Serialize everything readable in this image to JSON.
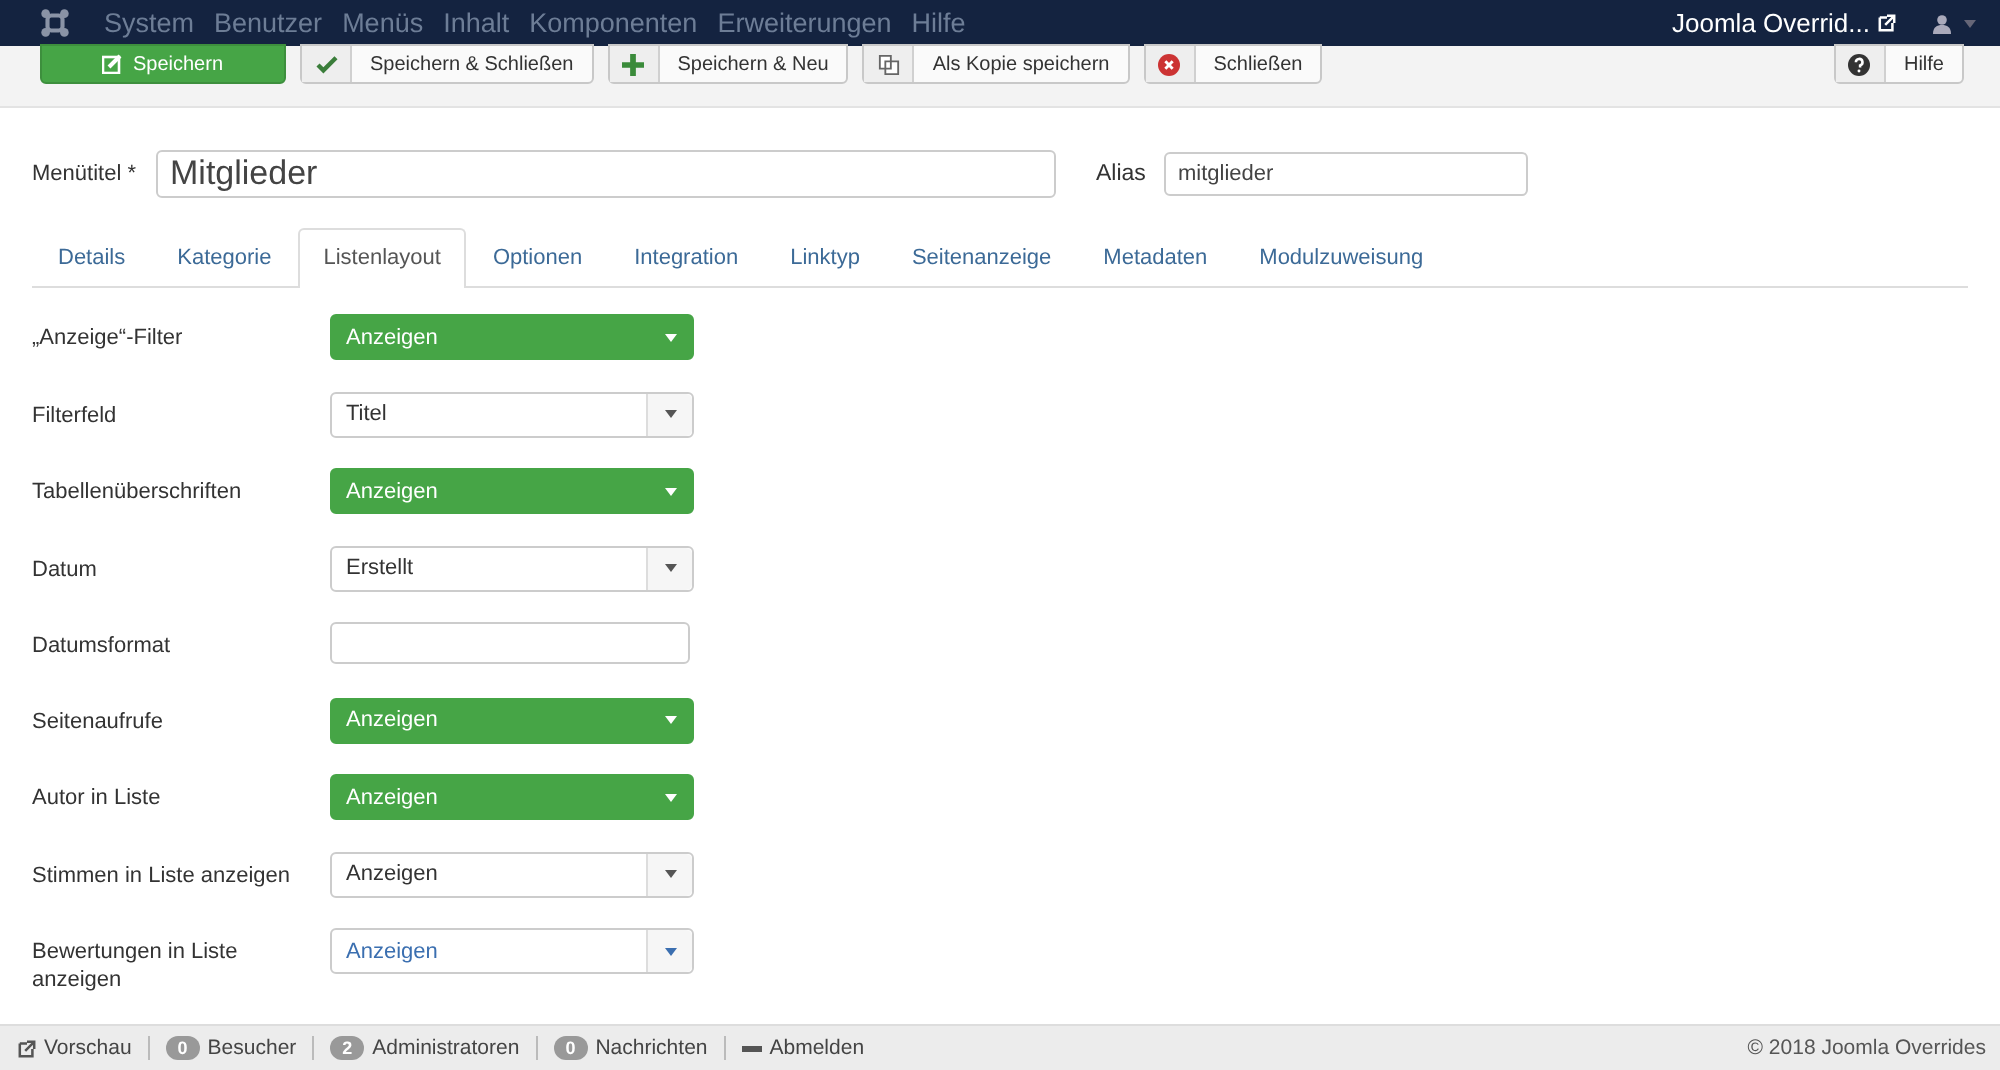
{
  "navbar": {
    "menu": [
      "System",
      "Benutzer",
      "Menüs",
      "Inhalt",
      "Komponenten",
      "Erweiterungen",
      "Hilfe"
    ],
    "site_link": "Joomla Overrid..."
  },
  "toolbar": {
    "buttons": [
      {
        "label": "Speichern",
        "kind": "primary"
      },
      {
        "label": "Speichern & Schließen",
        "kind": "default"
      },
      {
        "label": "Speichern & Neu",
        "kind": "default"
      },
      {
        "label": "Als Kopie speichern",
        "kind": "default"
      },
      {
        "label": "Schließen",
        "kind": "default"
      }
    ],
    "help_button": "Hilfe"
  },
  "title_row": {
    "label": "Menütitel *",
    "value": "Mitglieder",
    "alias_label": "Alias",
    "alias_value": "mitglieder"
  },
  "tabs": [
    {
      "label": "Details",
      "selected": false
    },
    {
      "label": "Kategorie",
      "selected": false
    },
    {
      "label": "Listenlayout",
      "selected": true
    },
    {
      "label": "Optionen",
      "selected": false
    },
    {
      "label": "Integration",
      "selected": false
    },
    {
      "label": "Linktyp",
      "selected": false
    },
    {
      "label": "Seitenanzeige",
      "selected": false
    },
    {
      "label": "Metadaten",
      "selected": false
    },
    {
      "label": "Modulzuweisung",
      "selected": false
    }
  ],
  "fields": [
    {
      "label": "„Anzeige“-Filter",
      "kind": "select",
      "value": "Anzeigen",
      "highlighted": true,
      "focused": false
    },
    {
      "label": "Filterfeld",
      "kind": "select",
      "value": "Titel",
      "highlighted": false,
      "focused": false
    },
    {
      "label": "Tabellenüberschriften",
      "kind": "select",
      "value": "Anzeigen",
      "highlighted": true,
      "focused": false
    },
    {
      "label": "Datum",
      "kind": "select",
      "value": "Erstellt",
      "highlighted": false,
      "focused": false
    },
    {
      "label": "Datumsformat",
      "kind": "text"
    },
    {
      "label": "Seitenaufrufe",
      "kind": "select",
      "value": "Anzeigen",
      "highlighted": true,
      "focused": false
    },
    {
      "label": "Autor in Liste",
      "kind": "select",
      "value": "Anzeigen",
      "highlighted": true,
      "focused": false
    },
    {
      "label": "Stimmen in Liste anzeigen",
      "kind": "select",
      "value": "Anzeigen",
      "highlighted": false,
      "focused": false
    },
    {
      "label": "Bewertungen in Liste anzeigen",
      "kind": "select",
      "value": "Anzeigen",
      "highlighted": false,
      "focused": true
    }
  ],
  "status_bar": {
    "items": [
      {
        "kind": "link",
        "label": "Vorschau"
      },
      {
        "kind": "count",
        "count": "0",
        "label": "Besucher"
      },
      {
        "kind": "count",
        "count": "2",
        "label": "Administratoren"
      },
      {
        "kind": "count",
        "count": "0",
        "label": "Nachrichten"
      },
      {
        "kind": "logout",
        "label": "Abmelden"
      }
    ],
    "copyright": "© 2018 Joomla Overrides"
  }
}
